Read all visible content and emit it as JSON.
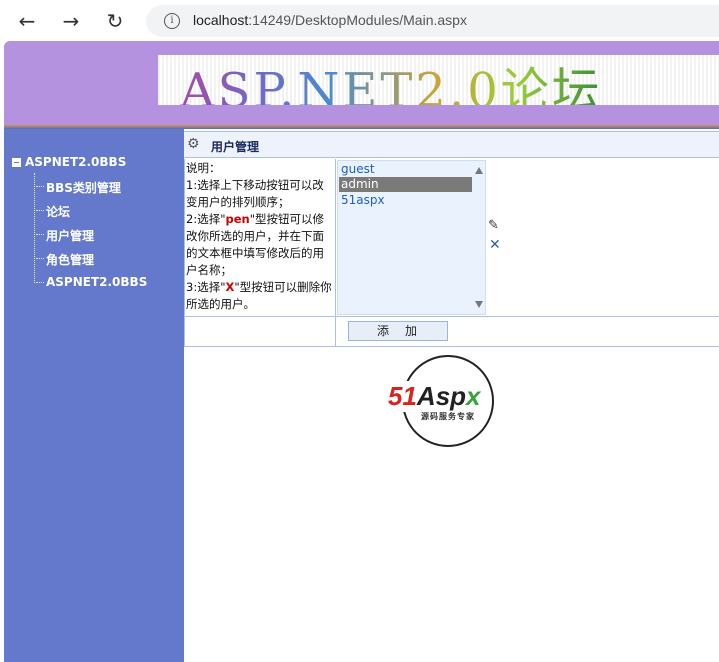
{
  "browser": {
    "back_icon": "arrow-left-icon",
    "forward_icon": "arrow-right-icon",
    "reload_icon": "reload-icon",
    "url_host": "localhost",
    "url_rest": ":14249/DesktopModules/Main.aspx"
  },
  "banner": {
    "title": "ASP.NET2.0论坛"
  },
  "sidebar": {
    "root": "ASPNET2.0BBS",
    "items": [
      {
        "label": "BBS类别管理"
      },
      {
        "label": "论坛"
      },
      {
        "label": "用户管理"
      },
      {
        "label": "角色管理"
      },
      {
        "label": "ASPNET2.0BBS"
      }
    ]
  },
  "panel": {
    "title": "用户管理",
    "desc": {
      "l1": "说明：",
      "l2": "1:选择上下移动按钮可以改变用户的排列顺序；",
      "l3a": "2:选择\"",
      "l3b": "pen",
      "l3c": "\"型按钮可以修改你所选的用户，并在下面的文本框中填写修改后的用户名称；",
      "l4a": "3:选择\"",
      "l4b": "X",
      "l4c": "\"型按钮可以删除你所选的用户。"
    },
    "users": [
      "guest",
      "admin",
      "51aspx"
    ],
    "selected_user": "admin",
    "add_label": "添加"
  },
  "logo": {
    "part1": "51",
    "part2": "Asp",
    "part3": "x",
    "sub": "源码服务专家"
  },
  "colors": {
    "banner": "#b492e0",
    "sidebar": "#6478cc",
    "accent_red": "#cc0000"
  }
}
